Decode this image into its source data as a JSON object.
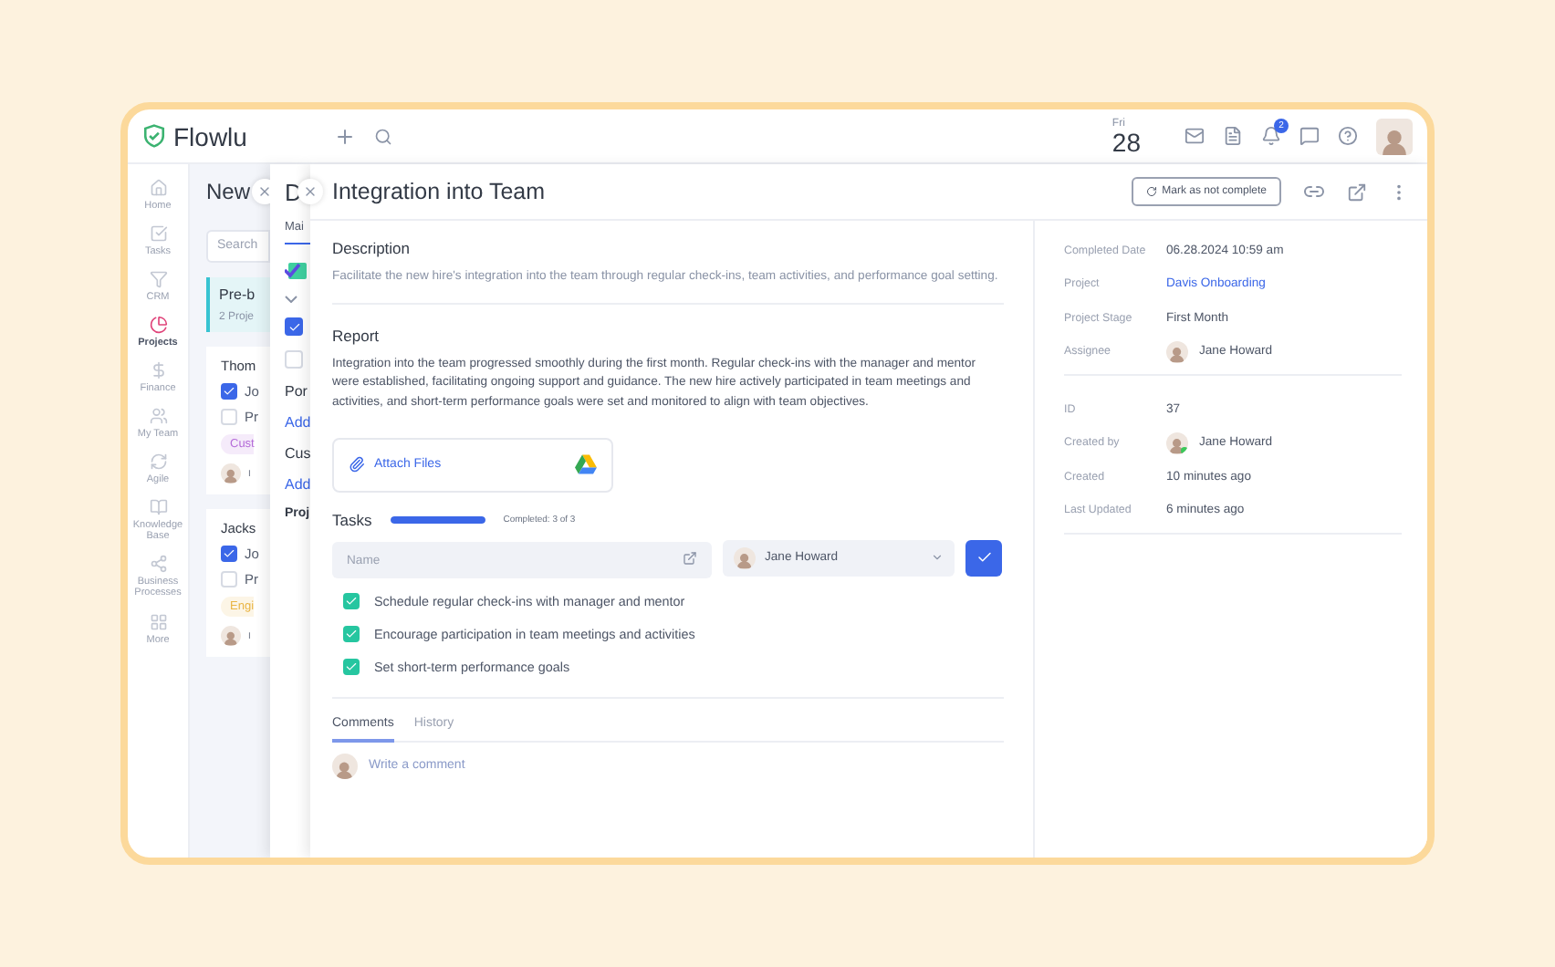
{
  "app": {
    "logo": "Flowlu"
  },
  "topbar": {
    "day": "Fri",
    "date": "28",
    "notifications": "2"
  },
  "sidebar": {
    "items": [
      {
        "label": "Home",
        "selected": false
      },
      {
        "label": "Tasks",
        "selected": false
      },
      {
        "label": "CRM",
        "selected": false
      },
      {
        "label": "Projects",
        "selected": true
      },
      {
        "label": "Finance",
        "selected": false
      },
      {
        "label": "My Team",
        "selected": false
      },
      {
        "label": "Agile",
        "selected": false
      },
      {
        "label": "Knowledge Base",
        "selected": false
      },
      {
        "label": "Business Processes",
        "selected": false
      },
      {
        "label": "More",
        "selected": false
      }
    ]
  },
  "back_panel": {
    "title": "New",
    "search_placeholder": "Search",
    "group": {
      "title": "Pre-b",
      "subtitle": "2 Proje"
    },
    "cards": [
      {
        "title": "Thom",
        "tasks": [
          {
            "label": "Jo",
            "checked": true
          },
          {
            "label": "Pr",
            "checked": false
          }
        ],
        "tag": {
          "label": "Cust",
          "color": "#b46ad8"
        },
        "owner": "I"
      },
      {
        "title": "Jacks",
        "tasks": [
          {
            "label": "Jo",
            "checked": true
          },
          {
            "label": "Pr",
            "checked": false
          }
        ],
        "tag": {
          "label": "Engi",
          "color": "#e9b545"
        },
        "owner": "I"
      }
    ]
  },
  "middle_panel": {
    "title": "D",
    "tab": "Mai",
    "checkboxes": [
      {
        "checked": true
      },
      {
        "checked": false
      }
    ],
    "sections": [
      {
        "title": "Por",
        "action": "Add"
      },
      {
        "title": "Cus",
        "action": "Add"
      },
      {
        "title": "Proj"
      }
    ]
  },
  "task": {
    "title": "Integration into Team",
    "mark_button": "Mark as not complete",
    "description": {
      "heading": "Description",
      "text": "Facilitate the new hire's integration into the team through regular check-ins, team activities, and performance goal setting."
    },
    "report": {
      "heading": "Report",
      "text": "Integration into the team progressed smoothly during the first month. Regular check-ins with the manager and mentor were established, facilitating ongoing support and guidance. The new hire actively participated in team meetings and activities, and short-term performance goals were set and monitored to align with team objectives."
    },
    "attach": "Attach Files",
    "tasks": {
      "heading": "Tasks",
      "level": 1,
      "progress_text": "Completed: 3 of 3",
      "name_placeholder": "Name",
      "assignee": "Jane Howard",
      "items": [
        {
          "label": "Schedule regular check-ins with manager and mentor",
          "checked": true
        },
        {
          "label": "Encourage participation in team meetings and activities",
          "checked": true
        },
        {
          "label": "Set short-term performance goals",
          "checked": true
        }
      ]
    },
    "tabs": [
      {
        "label": "Comments",
        "selected": true
      },
      {
        "label": "History",
        "selected": false
      }
    ],
    "comment_placeholder": "Write a comment"
  },
  "details": {
    "groups": [
      [
        {
          "label": "Completed Date",
          "kind": "text",
          "value": "06.28.2024 10:59 am"
        },
        {
          "label": "Project",
          "kind": "link",
          "value": "Davis Onboarding"
        },
        {
          "label": "Project Stage",
          "kind": "text",
          "value": "First Month"
        },
        {
          "label": "Assignee",
          "kind": "user",
          "value": "Jane Howard",
          "online": false
        }
      ],
      [
        {
          "label": "ID",
          "kind": "text",
          "value": "37"
        },
        {
          "label": "Created by",
          "kind": "user",
          "value": "Jane Howard",
          "online": true
        },
        {
          "label": "Created",
          "kind": "text",
          "value": "10 minutes ago"
        },
        {
          "label": "Last Updated",
          "kind": "text",
          "value": "6 minutes ago"
        }
      ]
    ]
  }
}
